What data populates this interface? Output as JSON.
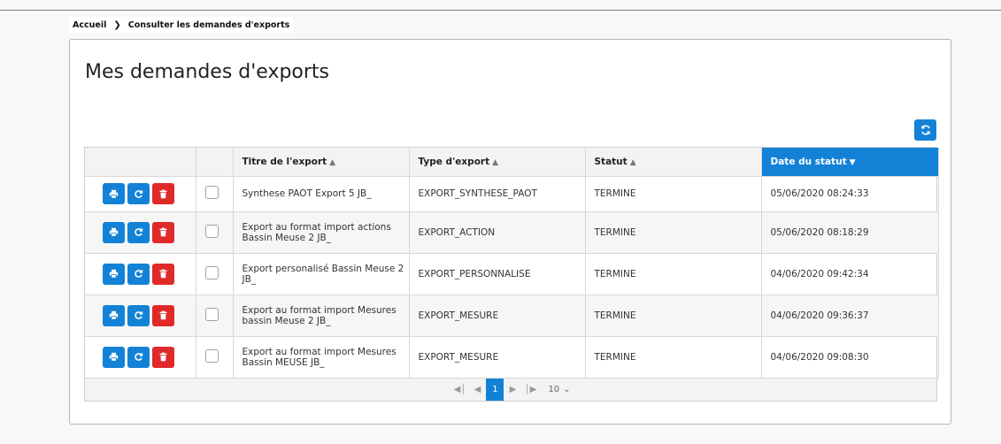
{
  "breadcrumb": {
    "home": "Accueil",
    "current": "Consulter les demandes d'exports"
  },
  "page": {
    "title": "Mes demandes d'exports"
  },
  "table": {
    "columns": [
      "Titre de l'export",
      "Type d'export",
      "Statut",
      "Date du statut"
    ],
    "active_sort_column": "Date du statut",
    "rows": [
      {
        "title": "Synthese PAOT Export 5 JB_",
        "type": "EXPORT_SYNTHESE_PAOT",
        "status": "TERMINE",
        "date": "05/06/2020 08:24:33"
      },
      {
        "title": "Export au format import actions Bassin Meuse 2 JB_",
        "type": "EXPORT_ACTION",
        "status": "TERMINE",
        "date": "05/06/2020 08:18:29"
      },
      {
        "title": "Export personalisé Bassin Meuse 2 JB_",
        "type": "EXPORT_PERSONNALISE",
        "status": "TERMINE",
        "date": "04/06/2020 09:42:34"
      },
      {
        "title": "Export au format import Mesures bassin Meuse 2 JB_",
        "type": "EXPORT_MESURE",
        "status": "TERMINE",
        "date": "04/06/2020 09:36:37"
      },
      {
        "title": "Export au format import Mesures Bassin MEUSE JB_",
        "type": "EXPORT_MESURE",
        "status": "TERMINE",
        "date": "04/06/2020 09:08:30"
      }
    ]
  },
  "pager": {
    "current_page": "1",
    "page_size": "10"
  },
  "colors": {
    "primary": "#1382d6",
    "danger": "#e02a2a"
  },
  "icons": {
    "print": "print-icon",
    "retry": "refresh-icon",
    "delete": "trash-icon"
  }
}
